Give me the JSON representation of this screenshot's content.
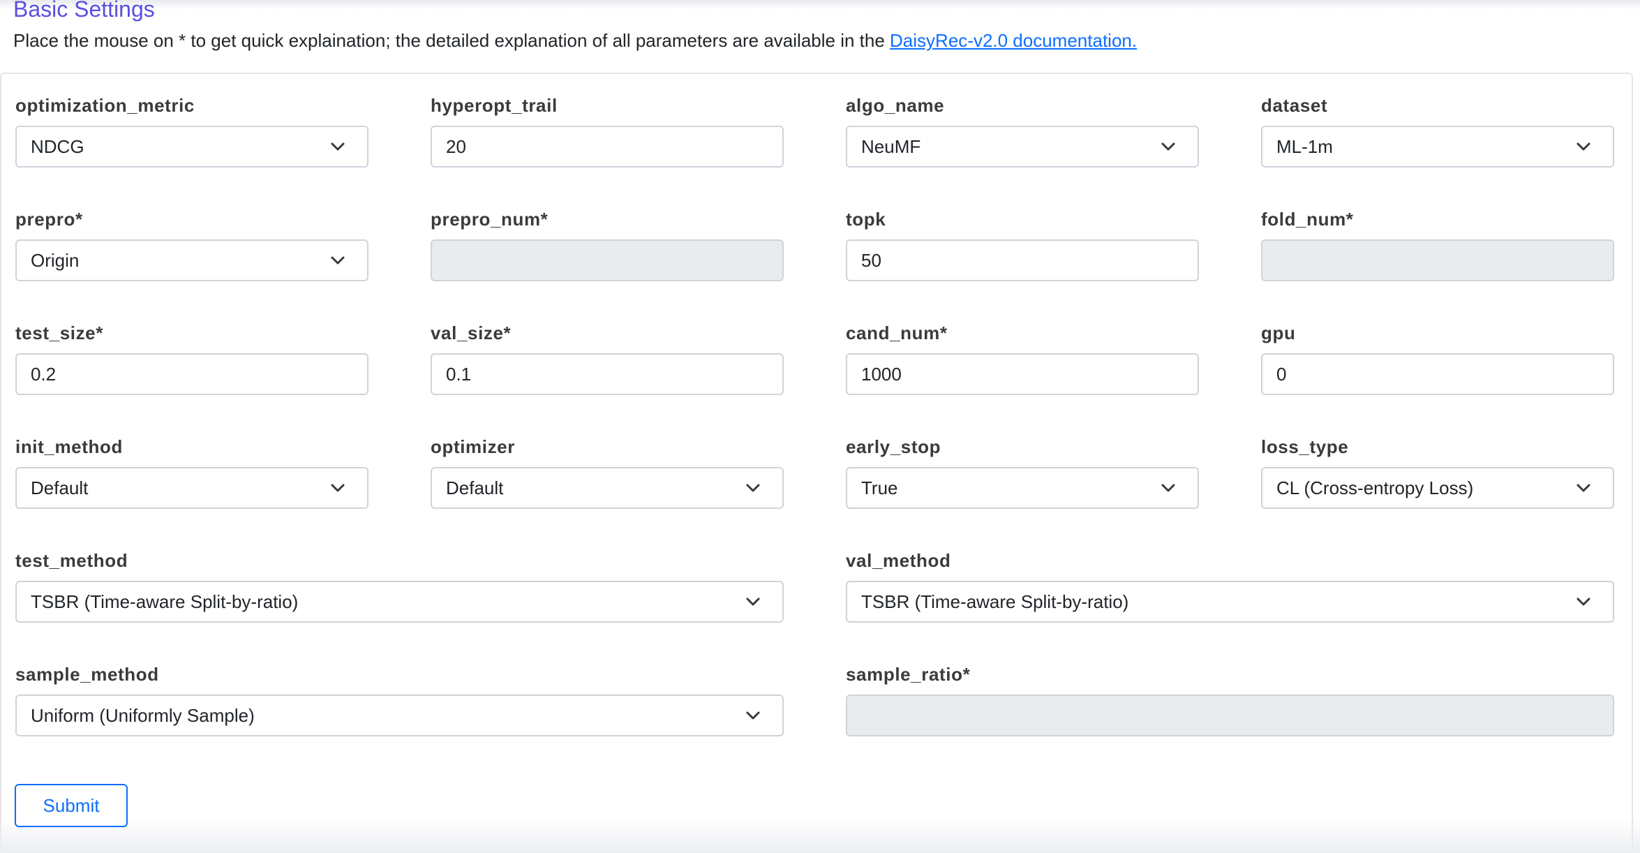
{
  "header": {
    "title": "Basic Settings",
    "intro_text": "Place the mouse on * to get quick explaination; the detailed explanation of all parameters are available in the ",
    "doc_link": "DaisyRec-v2.0 documentation."
  },
  "fields": {
    "optimization_metric": {
      "label": "optimization_metric",
      "value": "NDCG",
      "type": "select"
    },
    "hyperopt_trail": {
      "label": "hyperopt_trail",
      "value": "20",
      "type": "input"
    },
    "algo_name": {
      "label": "algo_name",
      "value": "NeuMF",
      "type": "select"
    },
    "dataset": {
      "label": "dataset",
      "value": "ML-1m",
      "type": "select"
    },
    "prepro": {
      "label": "prepro*",
      "value": "Origin",
      "type": "select"
    },
    "prepro_num": {
      "label": "prepro_num*",
      "value": "",
      "type": "input",
      "disabled": true
    },
    "topk": {
      "label": "topk",
      "value": "50",
      "type": "input"
    },
    "fold_num": {
      "label": "fold_num*",
      "value": "",
      "type": "input",
      "disabled": true
    },
    "test_size": {
      "label": "test_size*",
      "value": "0.2",
      "type": "input"
    },
    "val_size": {
      "label": "val_size*",
      "value": "0.1",
      "type": "input"
    },
    "cand_num": {
      "label": "cand_num*",
      "value": "1000",
      "type": "input"
    },
    "gpu": {
      "label": "gpu",
      "value": "0",
      "type": "input"
    },
    "init_method": {
      "label": "init_method",
      "value": "Default",
      "type": "select"
    },
    "optimizer": {
      "label": "optimizer",
      "value": "Default",
      "type": "select"
    },
    "early_stop": {
      "label": "early_stop",
      "value": "True",
      "type": "select"
    },
    "loss_type": {
      "label": "loss_type",
      "value": "CL (Cross-entropy Loss)",
      "type": "select"
    },
    "test_method": {
      "label": "test_method",
      "value": "TSBR (Time-aware Split-by-ratio)",
      "type": "select"
    },
    "val_method": {
      "label": "val_method",
      "value": "TSBR (Time-aware Split-by-ratio)",
      "type": "select"
    },
    "sample_method": {
      "label": "sample_method",
      "value": "Uniform (Uniformly Sample)",
      "type": "select"
    },
    "sample_ratio": {
      "label": "sample_ratio*",
      "value": "",
      "type": "input",
      "disabled": true
    }
  },
  "icons": {
    "select_arrow": "chevron-down-icon"
  },
  "colors": {
    "title": "#5a4fe0",
    "link": "#0d6efd",
    "disabled_bg": "#e9ecef",
    "border": "#ced4da"
  },
  "submit_label": "Submit"
}
